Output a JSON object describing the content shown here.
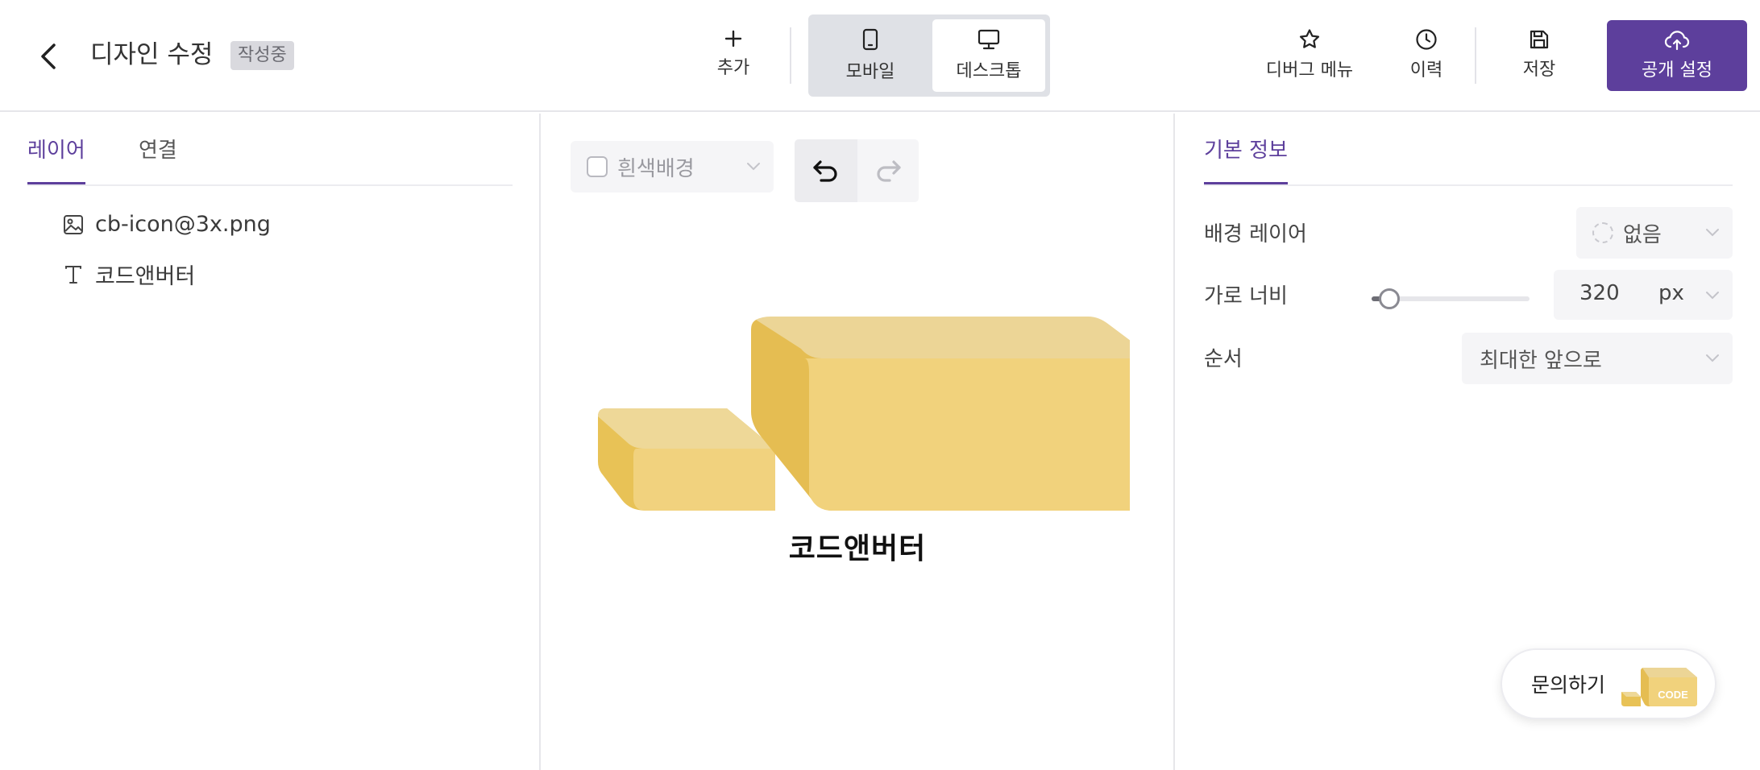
{
  "header": {
    "title": "디자인 수정",
    "status": "작성중",
    "add_label": "추가",
    "mobile_label": "모바일",
    "desktop_label": "데스크톱",
    "debug_label": "디버그 메뉴",
    "history_label": "이력",
    "save_label": "저장",
    "publish_label": "공개 설정"
  },
  "left_panel": {
    "tabs": [
      {
        "label": "레이어",
        "active": true
      },
      {
        "label": "연결",
        "active": false
      }
    ],
    "layers": [
      {
        "icon": "image-icon",
        "label": "cb-icon@3x.png"
      },
      {
        "icon": "text-icon",
        "label": "코드앤버터"
      }
    ]
  },
  "canvas": {
    "background_select": "흰색배경",
    "text": "코드앤버터"
  },
  "right_panel": {
    "tab": "기본 정보",
    "bg_layer_label": "배경 레이어",
    "bg_layer_value": "없음",
    "width_label": "가로 너비",
    "width_value": "320",
    "width_unit": "px",
    "width_slider_level": 0.09,
    "order_label": "순서",
    "order_value": "최대한 앞으로"
  },
  "inquiry": {
    "label": "문의하기",
    "logo_text": "CODE"
  },
  "colors": {
    "accent": "#5d3f9c",
    "butter_light": "#f1d27a",
    "butter_dark": "#e5c05a"
  }
}
